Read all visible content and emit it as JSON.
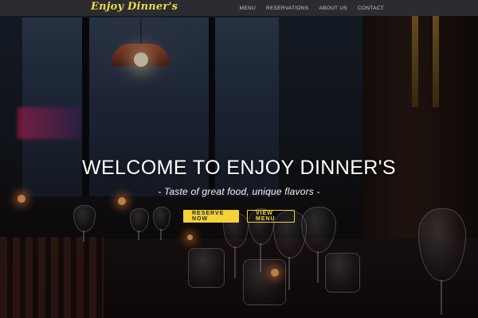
{
  "navbar": {
    "brand": "Enjoy Dinner's",
    "links": [
      "MENU",
      "RESERVATIONS",
      "ABOUT US",
      "CONTACT"
    ]
  },
  "hero": {
    "title": "WELCOME TO ENJOY DINNER'S",
    "subtitle": "- Taste of great food, unique flavors -",
    "buttons": {
      "reserve": "RESERVE NOW",
      "menu": "VIEW MENU"
    }
  },
  "colors": {
    "accent": "#f3d23a",
    "navbar_bg": "#2a2c30",
    "nav_text": "#c9c9c9",
    "hero_text": "#ffffff"
  },
  "icons": {
    "background": "restaurant-interior-photo"
  }
}
